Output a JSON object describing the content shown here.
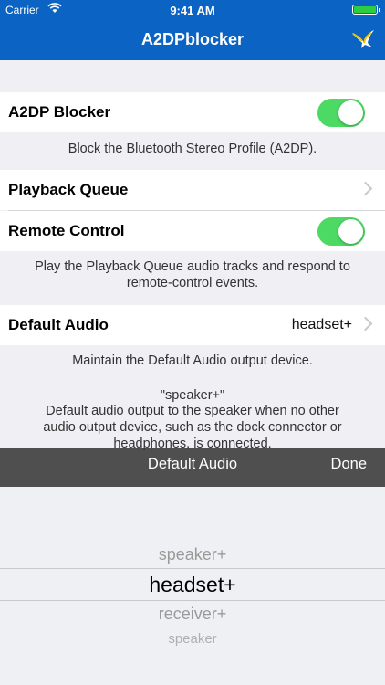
{
  "status": {
    "carrier": "Carrier",
    "time": "9:41 AM",
    "wifi_icon": "wifi-icon",
    "battery_icon": "battery-icon"
  },
  "nav": {
    "title": "A2DPblocker",
    "icon": "swallow-bird-icon"
  },
  "a2dp": {
    "label": "A2DP Blocker",
    "enabled": true,
    "footer": "Block the Bluetooth Stereo Profile (A2DP)."
  },
  "playback": {
    "label": "Playback Queue"
  },
  "remote": {
    "label": "Remote Control",
    "enabled": true
  },
  "remote_footer": [
    "Play the Playback Queue audio tracks and respond to",
    "remote-control events."
  ],
  "default_audio": {
    "label": "Default Audio",
    "value": "headset+",
    "footer": "Maintain the Default Audio output device.",
    "speaker_title": "\"speaker+\"",
    "speaker_desc": [
      "Default audio output to the speaker when no other",
      "audio output device, such as the dock connector or",
      "headphones, is connected."
    ]
  },
  "picker_toolbar": {
    "title": "Default Audio",
    "done": "Done"
  },
  "picker_options": [
    "speaker+",
    "headset+",
    "receiver+",
    "speaker"
  ],
  "colors": {
    "nav_bg": "#0b63c4",
    "toggle_on": "#4cd964"
  }
}
